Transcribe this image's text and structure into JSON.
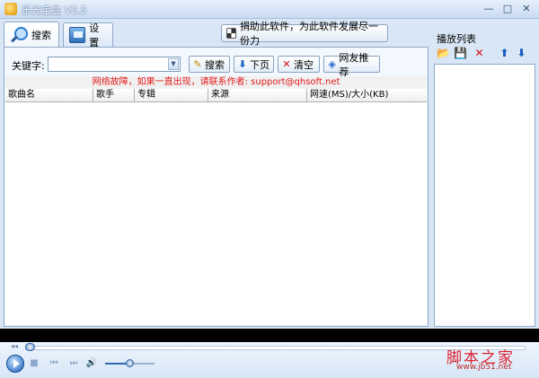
{
  "window": {
    "title": "乐光宝盒 V2.5",
    "controls": {
      "minimize": "—",
      "maximize": "□",
      "close": "✕"
    }
  },
  "tabs": [
    {
      "label": "搜索",
      "icon": "magnifier-icon",
      "active": true
    },
    {
      "label": "设置",
      "icon": "monitor-icon",
      "active": false
    }
  ],
  "donate": {
    "label": "捐助此软件，为此软件发展尽一份力",
    "icon": "donate-icon"
  },
  "search": {
    "keyword_label": "关键字:",
    "keyword_value": "",
    "buttons": {
      "search": "搜索",
      "next_page": "下页",
      "clear": "清空",
      "recommend": "网友推荐"
    }
  },
  "notice": "网络故障，如果一直出现，请联系作者: support@qhsoft.net",
  "table": {
    "columns": [
      "歌曲名",
      "歌手",
      "专辑",
      "来源",
      "网速(MS)/大小(KB)"
    ],
    "rows": []
  },
  "playlist": {
    "title": "播放列表",
    "tools": [
      "open-folder-icon",
      "save-icon",
      "delete-icon",
      "move-up-icon",
      "move-down-icon"
    ],
    "items": []
  },
  "player": {
    "seek_progress": 0,
    "volume": 0.5,
    "controls": [
      "play-icon",
      "stop-icon",
      "previous-icon",
      "next-icon",
      "volume-icon"
    ]
  },
  "watermark": {
    "title": "脚本之家",
    "url": "www.jb51.net"
  },
  "colors": {
    "notice_text": "#e21818",
    "accent": "#1a5fc0"
  }
}
